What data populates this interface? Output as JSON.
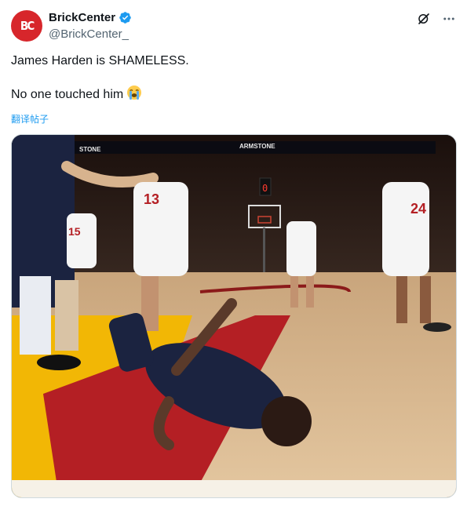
{
  "author": {
    "display_name": "BrickCenter",
    "handle": "@BrickCenter_",
    "avatar_text": "BC",
    "verified": true,
    "accent_color": "#d7262b",
    "verified_color": "#1d9bf0"
  },
  "actions": {
    "grok_icon": "grok-icon",
    "more_icon": "more-icon"
  },
  "tweet": {
    "line1": "James Harden is SHAMELESS.",
    "line2": "No one touched him",
    "emoji": "loudly-crying-face",
    "translate_label": "翻译帖子"
  },
  "media": {
    "type": "video-frame",
    "arena_signage": [
      "STONE",
      "ARMSTONE"
    ],
    "jersey_numbers": [
      "13",
      "15",
      "24"
    ],
    "scoreboard_digits": "0"
  }
}
